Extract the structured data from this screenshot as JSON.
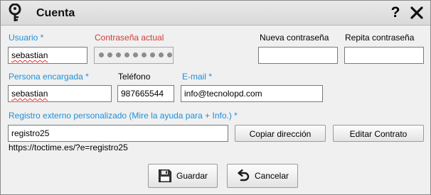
{
  "window": {
    "title": "Cuenta"
  },
  "icons": {
    "app": "key-icon",
    "help": "help-icon",
    "close": "close-icon",
    "save": "floppy-disk-icon",
    "cancel": "undo-arrow-icon"
  },
  "form": {
    "usuario": {
      "label": "Usuario *",
      "value": "sebastian"
    },
    "contrasena_actual": {
      "label": "Contraseña actual",
      "masked_length": 10
    },
    "nueva_contrasena": {
      "label": "Nueva contraseña",
      "value": ""
    },
    "repita_contrasena": {
      "label": "Repita contraseña",
      "value": ""
    },
    "persona_encargada": {
      "label": "Persona encargada *",
      "value": "sebastian"
    },
    "telefono": {
      "label": "Teléfono",
      "value": "987665544"
    },
    "email": {
      "label": "E-mail *",
      "value": "info@tecnolopd.com"
    },
    "registro_externo": {
      "label": "Registro externo personalizado (Mire la ayuda para + Info.) *",
      "value": "registro25",
      "url": "https://toctime.es/?e=registro25"
    }
  },
  "buttons": {
    "copiar": "Copiar dirección",
    "editar": "Editar Contrato",
    "guardar": "Guardar",
    "cancelar": "Cancelar"
  },
  "colors": {
    "required_label": "#1e8fd8",
    "error_label": "#d23a3a"
  }
}
